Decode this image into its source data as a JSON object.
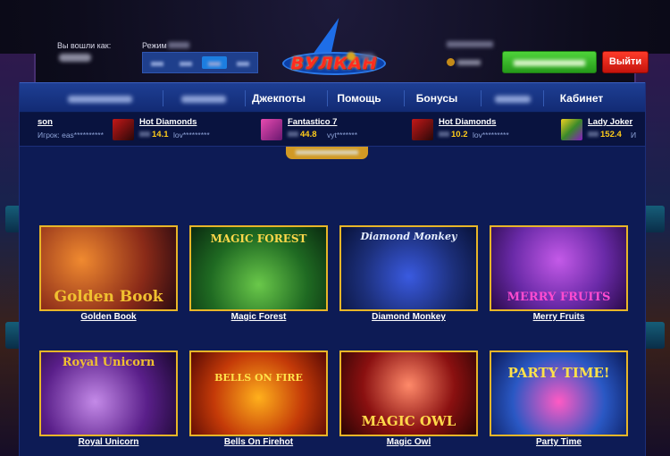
{
  "header": {
    "logged_in_label": "Вы вошли как:",
    "mode_label": "Режим",
    "logo_text": "ВУЛКАН",
    "exit_button": "Выйти"
  },
  "nav": {
    "items": [
      {
        "label": "",
        "blurred": true
      },
      {
        "label": "",
        "blurred": true
      },
      {
        "label": "Джекпоты"
      },
      {
        "label": "Помощь"
      },
      {
        "label": "Бонусы"
      },
      {
        "label": "",
        "blurred": true
      },
      {
        "label": "Кабинет"
      }
    ]
  },
  "ticker": [
    {
      "game": "son",
      "amount": "",
      "user": "Игрок: eas**********"
    },
    {
      "game": "Hot Diamonds",
      "amount": "14.1",
      "user": "lov*********"
    },
    {
      "game": "Fantastico 7",
      "amount": "44.8",
      "user": "vyt*******"
    },
    {
      "game": "Hot Diamonds",
      "amount": "10.2",
      "user": "lov*********"
    },
    {
      "game": "Lady Joker",
      "amount": "152.4",
      "user": "И"
    }
  ],
  "games": [
    {
      "title": "Golden Book",
      "art_text": "Golden Book",
      "art_color": "#f0c030",
      "bg": "#8a2a18"
    },
    {
      "title": "Magic Forest",
      "art_text": "MAGIC FOREST",
      "art_color": "#ffd84a",
      "bg": "#1f6a22"
    },
    {
      "title": "Diamond Monkey",
      "art_text": "Diamond Monkey",
      "art_color": "#e8f0ff",
      "bg": "#1c2f7a"
    },
    {
      "title": "Merry Fruits",
      "art_text": "MERRY FRUITS",
      "art_color": "#ff4bd0",
      "bg": "#6a2aa8"
    },
    {
      "title": "Royal Unicorn",
      "art_text": "Royal Unicorn",
      "art_color": "#f0c030",
      "bg": "#5a1f8a"
    },
    {
      "title": "Bells On Firehot",
      "art_text": "BELLS ON FIRE",
      "art_color": "#ffe14a",
      "bg": "#c43a08"
    },
    {
      "title": "Magic Owl",
      "art_text": "MAGIC OWL",
      "art_color": "#ffd84a",
      "bg": "#8a1010"
    },
    {
      "title": "Party Time",
      "art_text": "PARTY TIME!",
      "art_color": "#ffe14a",
      "bg": "#2a58c4"
    }
  ],
  "colors": {
    "deposit": "#3fbf2c",
    "exit": "#e8261a",
    "panel": "#0d1b55",
    "gold": "#ffcc1a"
  }
}
